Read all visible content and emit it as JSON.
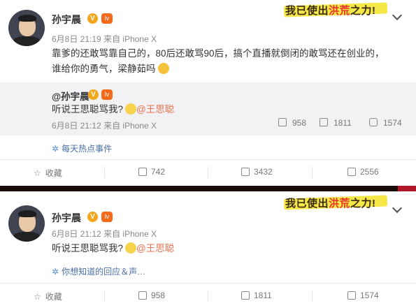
{
  "post1": {
    "author": "孙宇晨",
    "badge_v": "V",
    "level_badge": "lv",
    "time": "6月8日 21:19",
    "source": "来自 iPhone X",
    "text_line1": "靠爹的还敢骂靠自己的，80后还敢骂90后，搞个直播就倒闭的敢骂还在创业的，",
    "text_line2": "谁给你的勇气，梁静茹吗",
    "banner_pre": "我已使出",
    "banner_hl": "洪荒",
    "banner_post": "之力!",
    "quoted": {
      "author": "@孙宇晨",
      "text": "听说王思聪骂我?",
      "mention": "@王思聪",
      "time": "6月8日 21:12",
      "source": "来自 iPhone X",
      "repost_count": "958",
      "comment_count": "1811",
      "like_count": "1574"
    },
    "topic": "每天热点事件",
    "actions": {
      "collect": "收藏",
      "repost": "742",
      "comment": "3432",
      "like": "2556"
    }
  },
  "post2": {
    "author": "孙宇晨",
    "badge_v": "V",
    "level_badge": "lv",
    "time": "6月8日 21:12",
    "source": "来自 iPhone X",
    "text": "听说王思聪骂我?",
    "mention": "@王思聪",
    "banner_pre": "我已使出",
    "banner_hl": "洪荒",
    "banner_post": "之力!",
    "topic": "你想知道的回应＆声…",
    "actions": {
      "collect": "收藏",
      "repost": "958",
      "comment": "1811",
      "like": "1574"
    }
  },
  "colors": {
    "link": "#eb7350",
    "topic": "#4a6fa5",
    "badge_v": "#f3a51b",
    "quote_bg": "#f2f2f5"
  },
  "icons": [
    "avatar",
    "verified-v-icon",
    "level-badge-icon",
    "chevron-down-icon",
    "smile-emoji-icon",
    "topic-icon",
    "star-icon",
    "repost-icon",
    "comment-icon",
    "like-icon"
  ]
}
